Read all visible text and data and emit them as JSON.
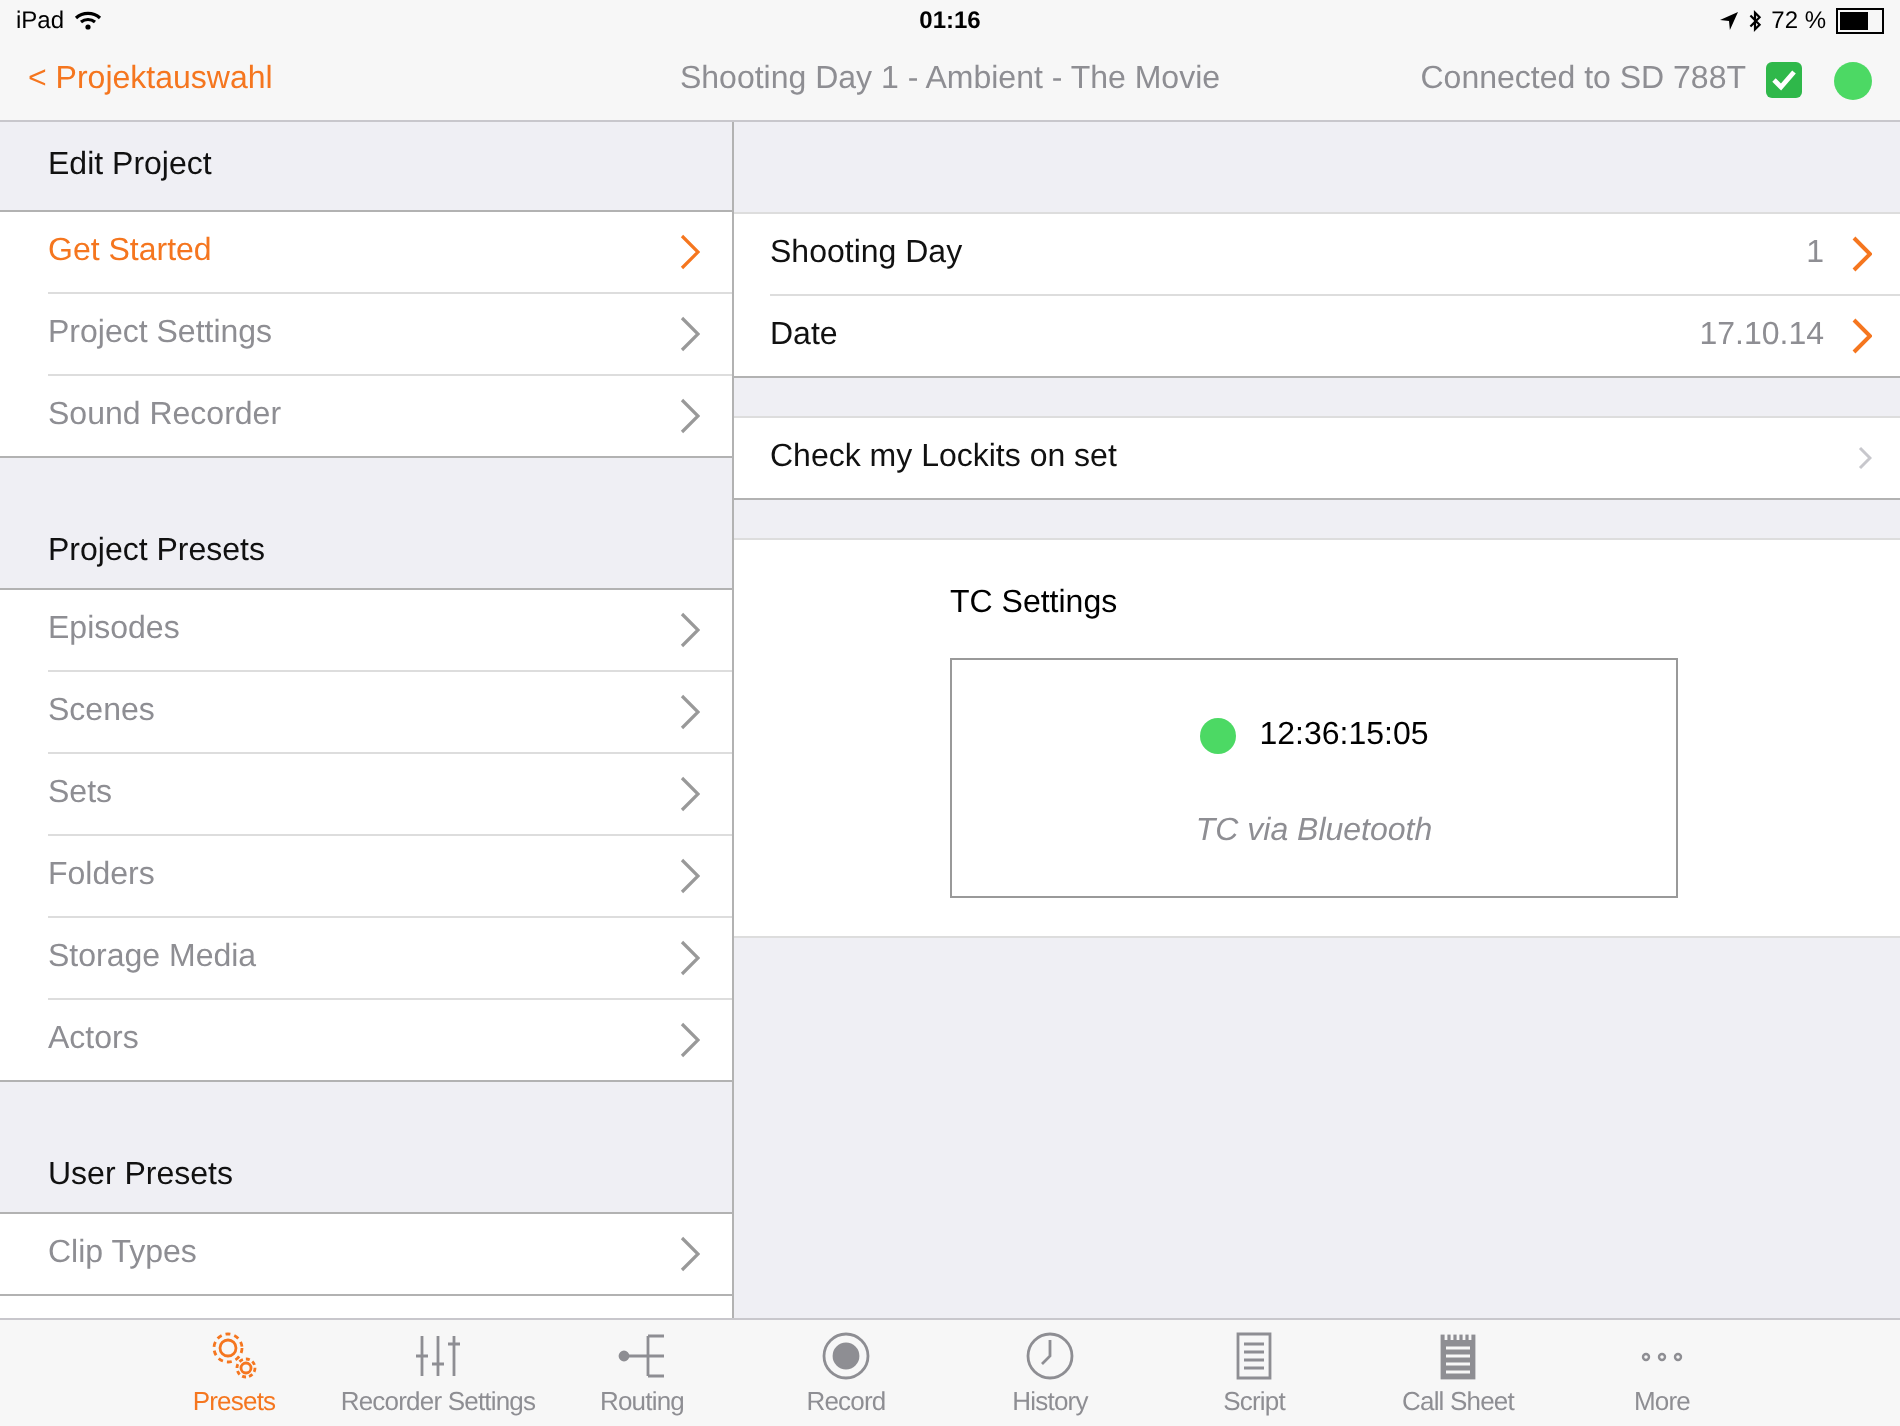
{
  "status_bar": {
    "device": "iPad",
    "time": "01:16",
    "battery": "72 %"
  },
  "nav_bar": {
    "back": "< Projektauswahl",
    "title": "Shooting Day 1 - Ambient - The Movie",
    "connection": "Connected to SD 788T",
    "connected": true
  },
  "sidebar": {
    "sections": [
      {
        "title": "Edit Project",
        "items": [
          {
            "label": "Get Started",
            "selected": true
          },
          {
            "label": "Project Settings",
            "selected": false
          },
          {
            "label": "Sound Recorder",
            "selected": false
          }
        ]
      },
      {
        "title": "Project Presets",
        "items": [
          {
            "label": "Episodes",
            "selected": false
          },
          {
            "label": "Scenes",
            "selected": false
          },
          {
            "label": "Sets",
            "selected": false
          },
          {
            "label": "Folders",
            "selected": false
          },
          {
            "label": "Storage Media",
            "selected": false
          },
          {
            "label": "Actors",
            "selected": false
          }
        ]
      },
      {
        "title": "User Presets",
        "items": [
          {
            "label": "Clip Types",
            "selected": false
          }
        ]
      }
    ]
  },
  "detail": {
    "rows": [
      {
        "label": "Shooting Day",
        "value": "1",
        "kind": "value"
      },
      {
        "label": "Date",
        "value": "17.10.14",
        "kind": "value"
      }
    ],
    "link_row": {
      "label": "Check my Lockits on set"
    },
    "tc": {
      "title": "TC Settings",
      "timecode": "12:36:15:05",
      "source": "TC via Bluetooth"
    }
  },
  "tab_bar": [
    {
      "label": "Presets",
      "selected": true
    },
    {
      "label": "Recorder Settings",
      "selected": false
    },
    {
      "label": "Routing",
      "selected": false
    },
    {
      "label": "Record",
      "selected": false
    },
    {
      "label": "History",
      "selected": false
    },
    {
      "label": "Script",
      "selected": false
    },
    {
      "label": "Call Sheet",
      "selected": false
    },
    {
      "label": "More",
      "selected": false
    }
  ]
}
